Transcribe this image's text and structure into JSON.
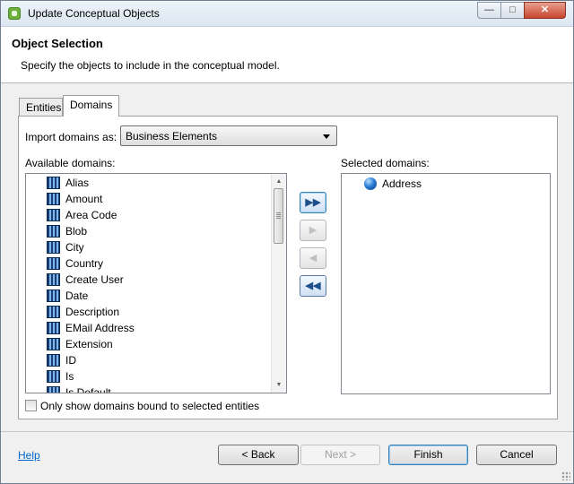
{
  "window": {
    "title": "Update Conceptual Objects",
    "controls": {
      "minimize": "—",
      "maximize": "□",
      "close": "✕"
    }
  },
  "header": {
    "title": "Object Selection",
    "description": "Specify the objects to include in the conceptual model."
  },
  "tabs": [
    {
      "label": "Entities",
      "active": false
    },
    {
      "label": "Domains",
      "active": true
    }
  ],
  "import": {
    "label": "Import domains as:",
    "selected": "Business Elements"
  },
  "available": {
    "label": "Available domains:",
    "items": [
      "Alias",
      "Amount",
      "Area Code",
      "Blob",
      "City",
      "Country",
      "Create User",
      "Date",
      "Description",
      "EMail Address",
      "Extension",
      "ID",
      "Is",
      "Is Default"
    ]
  },
  "selected": {
    "label": "Selected domains:",
    "items": [
      "Address"
    ]
  },
  "move_buttons": {
    "add_all": "▶▶",
    "add": "▶",
    "remove": "◀",
    "remove_all": "◀◀"
  },
  "filter_checkbox": {
    "label": "Only show domains bound to selected entities",
    "checked": false
  },
  "footer": {
    "help": "Help",
    "back": "< Back",
    "next": "Next >",
    "finish": "Finish",
    "cancel": "Cancel"
  },
  "icons": {
    "domain": "domain-icon",
    "selected_domain": "domain-ball-icon"
  }
}
